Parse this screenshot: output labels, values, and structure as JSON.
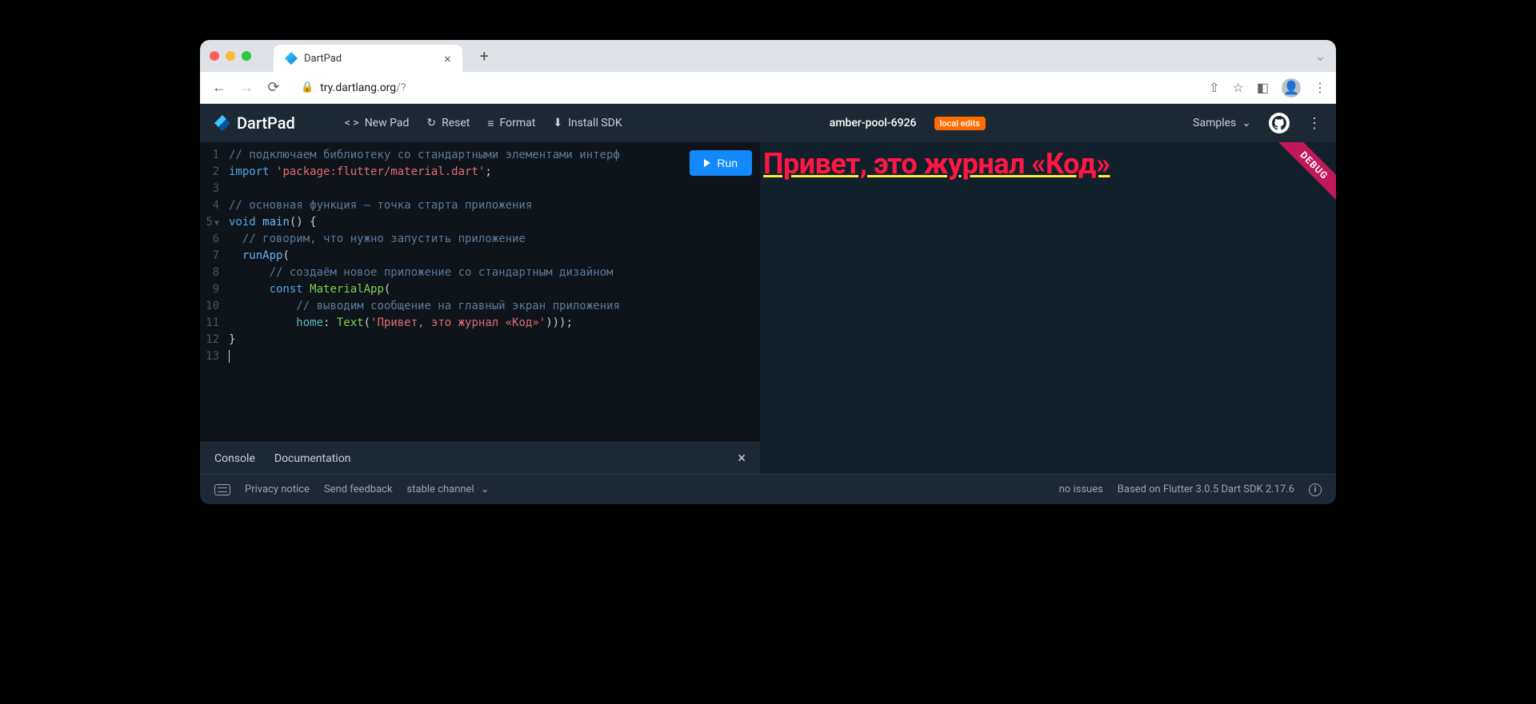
{
  "browser": {
    "tab_title": "DartPad",
    "url_host": "try.dartlang.org",
    "url_path": "/?"
  },
  "header": {
    "logo": "DartPad",
    "new_pad": "New Pad",
    "reset": "Reset",
    "format": "Format",
    "install_sdk": "Install SDK",
    "pool_name": "amber-pool-6926",
    "badge": "local edits",
    "samples": "Samples"
  },
  "editor": {
    "run": "Run",
    "lines": [
      {
        "n": "1",
        "html": "<span class='c-com'>// подключаем библиотеку со стандартными элементами интерф</span>"
      },
      {
        "n": "2",
        "html": "<span class='c-kw'>import</span> <span class='c-str'>'package:flutter/material.dart'</span>;"
      },
      {
        "n": "3",
        "html": ""
      },
      {
        "n": "4",
        "html": "<span class='c-com'>// основная функция — точка старта приложения</span>"
      },
      {
        "n": "5",
        "fold": true,
        "html": "<span class='c-kw'>void</span> <span class='c-fn'>main</span>() {"
      },
      {
        "n": "6",
        "html": "  <span class='c-com'>// говорим, что нужно запустить приложение</span>"
      },
      {
        "n": "7",
        "html": "  <span class='c-call'>runApp</span>("
      },
      {
        "n": "8",
        "html": "      <span class='c-com'>// создаём новое приложение со стандартным дизайном</span>"
      },
      {
        "n": "9",
        "html": "      <span class='c-kw'>const</span> <span class='c-type'>MaterialApp</span>("
      },
      {
        "n": "10",
        "html": "          <span class='c-com'>// выводим сообщение на главный экран приложения</span>"
      },
      {
        "n": "11",
        "html": "          <span class='c-prop'>home</span>: <span class='c-type'>Text</span>(<span class='c-str'>'Привет, это журнал «Код»'</span>)));"
      },
      {
        "n": "12",
        "html": "}"
      },
      {
        "n": "13",
        "html": "<span class='cursor'></span>"
      }
    ]
  },
  "output": {
    "text": "Привет, это журнал «Код»",
    "debug": "DEBUG"
  },
  "tabs": {
    "console": "Console",
    "documentation": "Documentation"
  },
  "footer": {
    "privacy": "Privacy notice",
    "feedback": "Send feedback",
    "channel": "stable channel",
    "issues": "no issues",
    "version": "Based on Flutter 3.0.5 Dart SDK 2.17.6"
  }
}
